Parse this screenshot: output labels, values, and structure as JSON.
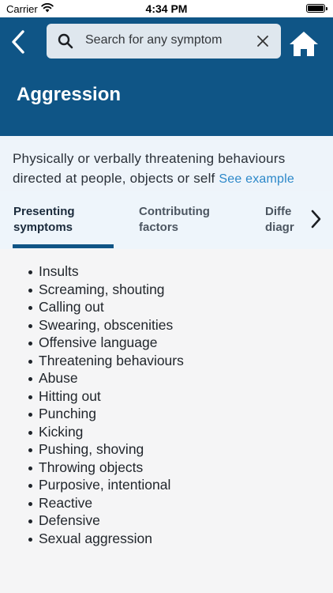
{
  "status_bar": {
    "carrier": "Carrier",
    "time": "4:34 PM",
    "wifi_icon": "wifi-icon",
    "battery_icon": "battery-icon"
  },
  "header": {
    "background_color": "#0f5586",
    "back_icon": "chevron-left-icon",
    "home_icon": "home-icon",
    "search": {
      "placeholder": "Search for any symptom",
      "search_icon": "search-icon",
      "clear_icon": "close-icon"
    },
    "title": "Aggression"
  },
  "description": {
    "text": "Physically or verbally threatening behaviours directed at people, objects or self",
    "link_label": "See example",
    "link_color": "#2c88c9"
  },
  "tabs": [
    {
      "line1": "Presenting",
      "line2": "symptoms",
      "active": true
    },
    {
      "line1": "Contributing",
      "line2": "factors",
      "active": false
    },
    {
      "line1": "Diffe",
      "line2": "diagr",
      "active": false
    }
  ],
  "tabs_next_icon": "chevron-right-icon",
  "symptoms": [
    "Insults",
    "Screaming, shouting",
    "Calling out",
    "Swearing, obscenities",
    "Offensive language",
    "Threatening behaviours",
    "Abuse",
    "Hitting out",
    "Punching",
    "Kicking",
    "Pushing, shoving",
    "Throwing objects",
    "Purposive, intentional",
    "Reactive",
    "Defensive",
    "Sexual aggression"
  ]
}
